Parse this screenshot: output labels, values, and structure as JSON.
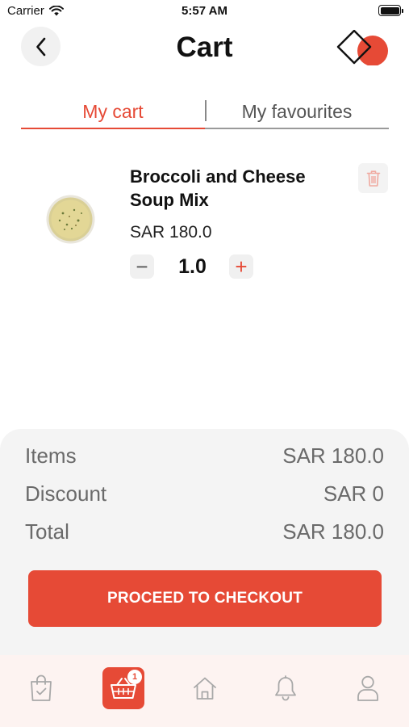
{
  "status_bar": {
    "carrier": "Carrier",
    "time": "5:57 AM",
    "wifi_icon": "wifi-icon",
    "battery_icon": "battery-icon"
  },
  "header": {
    "title": "Cart",
    "back_icon": "chevron-left-icon",
    "logo_icon": "brand-logo-icon"
  },
  "tabs": [
    {
      "label": "My cart",
      "active": true
    },
    {
      "label": "My favourites",
      "active": false
    }
  ],
  "cart": {
    "items": [
      {
        "name": "Broccoli and Cheese Soup Mix",
        "price": "SAR 180.0",
        "quantity": "1.0",
        "minus_label": "−",
        "plus_label": "+",
        "image_icon": "soup-bowl-image",
        "delete_icon": "trash-icon"
      }
    ]
  },
  "summary": {
    "rows": [
      {
        "label": "Items",
        "value": "SAR 180.0"
      },
      {
        "label": "Discount",
        "value": "SAR 0"
      },
      {
        "label": "Total",
        "value": "SAR 180.0"
      }
    ],
    "checkout_label": "PROCEED TO CHECKOUT"
  },
  "bottom_nav": {
    "items": [
      {
        "name": "orders",
        "icon": "shopping-bag-check-icon",
        "active": false
      },
      {
        "name": "cart",
        "icon": "basket-icon",
        "active": true,
        "badge": "1"
      },
      {
        "name": "home",
        "icon": "home-icon",
        "active": false
      },
      {
        "name": "notifications",
        "icon": "bell-icon",
        "active": false
      },
      {
        "name": "profile",
        "icon": "user-icon",
        "active": false
      }
    ]
  },
  "colors": {
    "accent": "#e64a36",
    "panel": "#f4f4f4",
    "nav_background": "#fdf3f1",
    "muted_text": "#6a6a6a"
  }
}
